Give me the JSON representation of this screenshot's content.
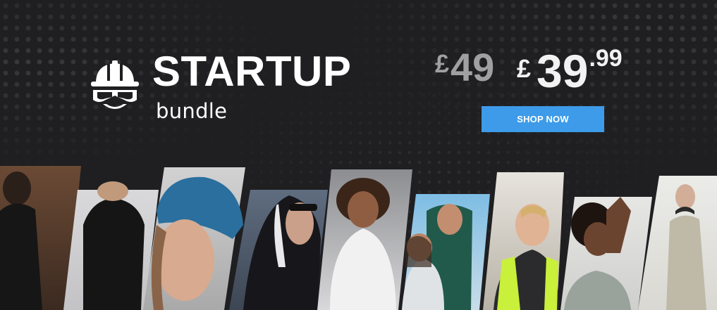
{
  "banner": {
    "title": "STARTUP",
    "subtitle": "bundle",
    "logo_icon": "hard-hat-goggles-icon"
  },
  "pricing": {
    "old_currency": "£",
    "old_amount": "49",
    "new_currency": "£",
    "new_amount": "39",
    "new_decimals": ".99"
  },
  "cta": {
    "label": "SHOP NOW",
    "color": "#3d9be9"
  },
  "colors": {
    "background": "#1f1f21",
    "text": "#ffffff",
    "old_price": "#a0a0a2"
  },
  "photos": [
    {
      "name": "photo-man-black-hoodie-back",
      "icon": "person-photo"
    },
    {
      "name": "photo-black-hoodie",
      "icon": "person-photo"
    },
    {
      "name": "photo-blue-beanie",
      "icon": "person-photo"
    },
    {
      "name": "photo-hooded-sunglasses",
      "icon": "person-photo"
    },
    {
      "name": "photo-white-sweatshirt",
      "icon": "person-photo"
    },
    {
      "name": "photo-couple-sweatshirts",
      "icon": "person-photo"
    },
    {
      "name": "photo-hi-vis-vest",
      "icon": "person-photo"
    },
    {
      "name": "photo-woman-hands-raised",
      "icon": "person-photo"
    },
    {
      "name": "photo-beige-workwear",
      "icon": "person-photo"
    }
  ]
}
